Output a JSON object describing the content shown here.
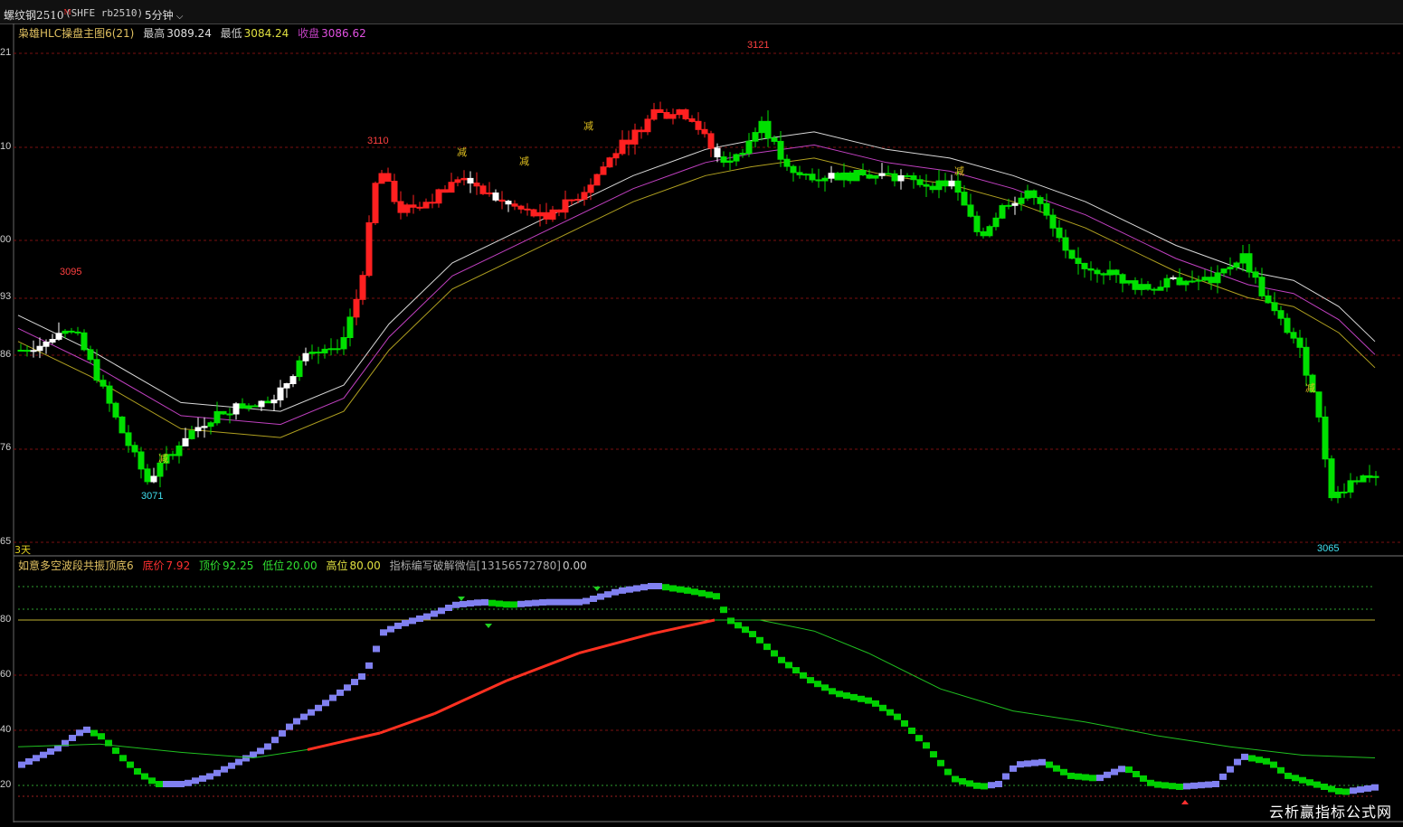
{
  "header": {
    "symbol": "螺纹钢2510",
    "symbol_sup": "M",
    "exchange_code": "(SHFE rb2510)",
    "period": "5分钟"
  },
  "main_legend": {
    "indicator": "枭雄HLC操盘主图6(21)",
    "high_label": "最高",
    "high_value": "3089.24",
    "low_label": "最低",
    "low_value": "3084.24",
    "close_label": "收盘",
    "close_value": "3086.62"
  },
  "sub_legend": {
    "indicator": "如意多空波段共振顶底6",
    "bottom_label": "底价",
    "bottom_value": "7.92",
    "top_label": "顶价",
    "top_value": "92.25",
    "low_label": "低位",
    "low_value": "20.00",
    "high_label": "高位",
    "high_value": "80.00",
    "note": "指标编写破解微信[13156572780]",
    "note_value": "0.00"
  },
  "main_axis_ticks": [
    "21",
    "10",
    "00",
    "93",
    "86",
    "76",
    "65"
  ],
  "sub_axis_ticks": [
    "80",
    "60",
    "40",
    "20"
  ],
  "extreme_labels": {
    "h1": "3095",
    "h2": "3110",
    "h3": "3121",
    "l1": "3071",
    "l2": "3065"
  },
  "marker_text": "减",
  "days_label": "3天",
  "watermark": "云析赢指标公式网",
  "colors": {
    "up": "#ff2020",
    "down": "#00e000",
    "white": "#ffffff",
    "ma_white": "#d8d8d8",
    "ma_magenta": "#c040c0",
    "ma_yellow": "#b0a020",
    "bar_purple": "#8080f0",
    "bar_green": "#00d000",
    "bar_red": "#ff3020"
  }
}
